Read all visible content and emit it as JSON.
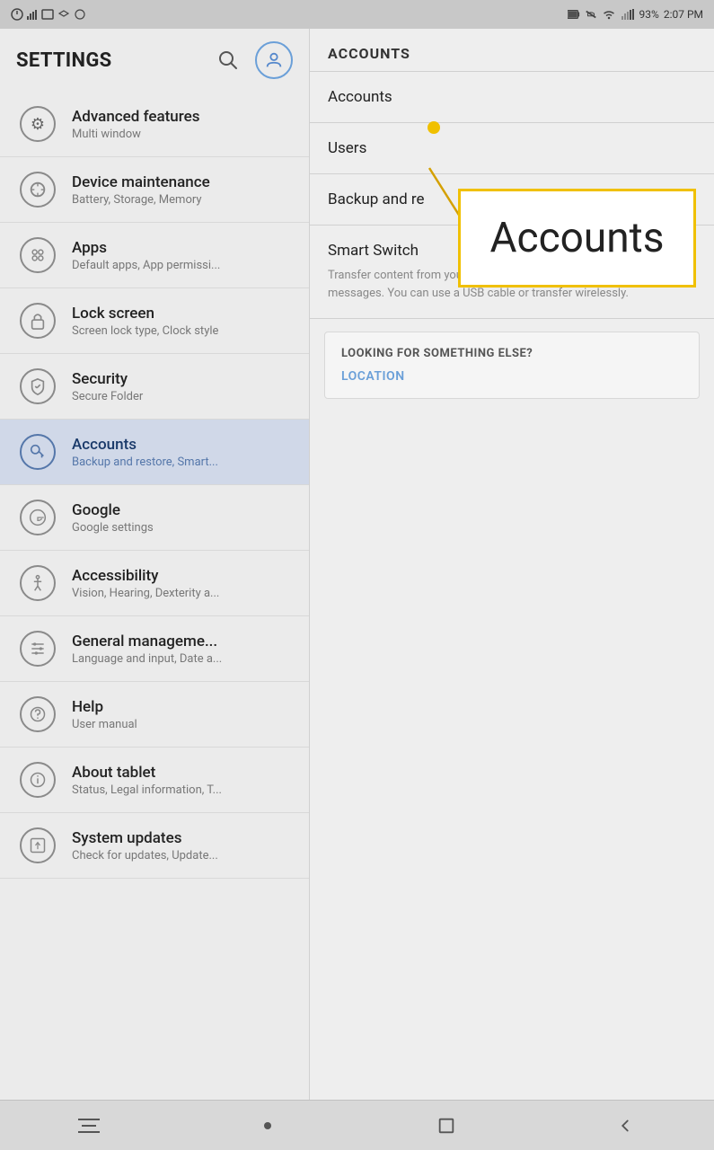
{
  "statusBar": {
    "time": "2:07 PM",
    "battery": "93%",
    "icons": [
      "battery",
      "wifi",
      "signal",
      "silent"
    ]
  },
  "sidebar": {
    "title": "SETTINGS",
    "items": [
      {
        "id": "advanced-features",
        "title": "Advanced features",
        "subtitle": "Multi window",
        "icon": "⚙",
        "active": false
      },
      {
        "id": "device-maintenance",
        "title": "Device maintenance",
        "subtitle": "Battery, Storage, Memory",
        "icon": "🔄",
        "active": false
      },
      {
        "id": "apps",
        "title": "Apps",
        "subtitle": "Default apps, App permissi...",
        "icon": "⠿",
        "active": false
      },
      {
        "id": "lock-screen",
        "title": "Lock screen",
        "subtitle": "Screen lock type, Clock style",
        "icon": "🔒",
        "active": false
      },
      {
        "id": "security",
        "title": "Security",
        "subtitle": "Secure Folder",
        "icon": "🛡",
        "active": false
      },
      {
        "id": "accounts",
        "title": "Accounts",
        "subtitle": "Backup and restore, Smart...",
        "icon": "🔑",
        "active": true
      },
      {
        "id": "google",
        "title": "Google",
        "subtitle": "Google settings",
        "icon": "G",
        "active": false
      },
      {
        "id": "accessibility",
        "title": "Accessibility",
        "subtitle": "Vision, Hearing, Dexterity a...",
        "icon": "♿",
        "active": false
      },
      {
        "id": "general-management",
        "title": "General manageme...",
        "subtitle": "Language and input, Date a...",
        "icon": "⚙",
        "active": false
      },
      {
        "id": "help",
        "title": "Help",
        "subtitle": "User manual",
        "icon": "?",
        "active": false
      },
      {
        "id": "about-tablet",
        "title": "About tablet",
        "subtitle": "Status, Legal information, T...",
        "icon": "ℹ",
        "active": false
      },
      {
        "id": "system-updates",
        "title": "System updates",
        "subtitle": "Check for updates, Update...",
        "icon": "🔃",
        "active": false
      }
    ]
  },
  "rightPanel": {
    "header": "ACCOUNTS",
    "menuItems": [
      {
        "id": "accounts",
        "title": "Accounts",
        "subtitle": ""
      },
      {
        "id": "users",
        "title": "Users",
        "subtitle": ""
      },
      {
        "id": "backup-restore",
        "title": "Backup and re",
        "subtitle": ""
      }
    ],
    "smartSwitch": {
      "title": "Smart Switch",
      "description": "Transfer content from your old device, including images, contacts, and messages. You can use a USB cable or transfer wirelessly."
    },
    "lookingFor": {
      "label": "LOOKING FOR SOMETHING ELSE?",
      "link": "LOCATION"
    }
  },
  "callout": {
    "text": "Accounts"
  },
  "bottomNav": {
    "buttons": [
      "menu",
      "home",
      "back"
    ]
  }
}
